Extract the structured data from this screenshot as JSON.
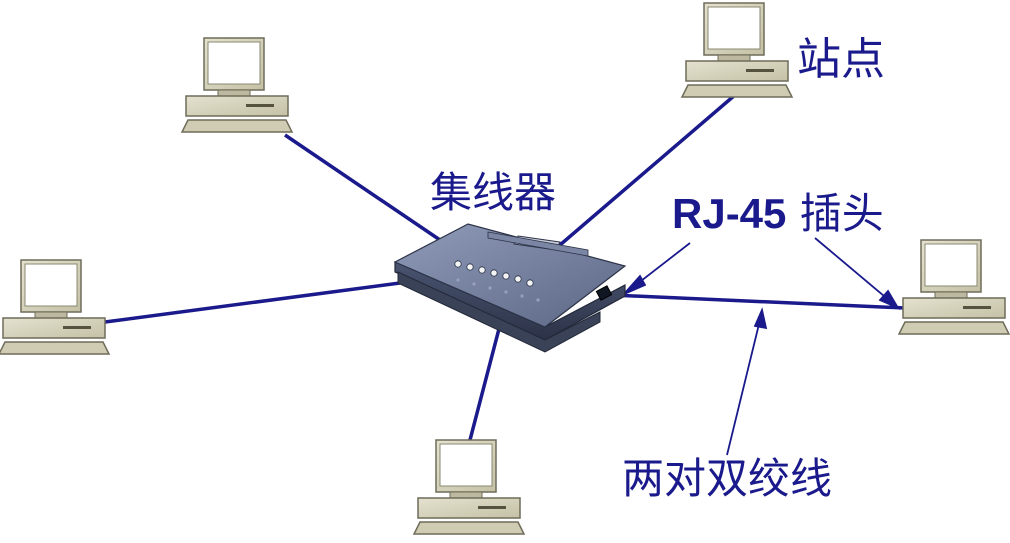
{
  "labels": {
    "station": "站点",
    "hub": "集线器",
    "rj45_prefix": "RJ-45",
    "rj45_suffix": " 插头",
    "cable": "两对双绞线"
  },
  "colors": {
    "cable": "#1a1a8c",
    "label": "#1a1a8c",
    "computer_body": "#d8d5bd",
    "hub_body": "#6c7896"
  }
}
